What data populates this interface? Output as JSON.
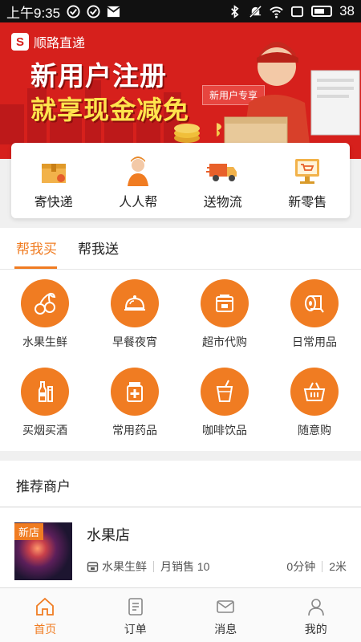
{
  "status_bar": {
    "time": "上午9:35",
    "battery": "38"
  },
  "banner": {
    "brand": "顺路直递",
    "slogan_line1": "新用户注册",
    "slogan_line2": "就享现金减免",
    "tag": "新用户专享"
  },
  "quick_services": [
    {
      "label": "寄快递",
      "icon": "package-icon"
    },
    {
      "label": "人人帮",
      "icon": "courier-icon"
    },
    {
      "label": "送物流",
      "icon": "truck-icon"
    },
    {
      "label": "新零售",
      "icon": "cart-screen-icon"
    }
  ],
  "tabs": {
    "buy": "帮我买",
    "send": "帮我送",
    "active": "buy"
  },
  "categories": [
    {
      "label": "水果生鲜",
      "icon": "cherry-icon"
    },
    {
      "label": "早餐夜宵",
      "icon": "food-dome-icon"
    },
    {
      "label": "超市代购",
      "icon": "store-icon"
    },
    {
      "label": "日常用品",
      "icon": "tissue-roll-icon"
    },
    {
      "label": "买烟买酒",
      "icon": "bottle-icon"
    },
    {
      "label": "常用药品",
      "icon": "medicine-icon"
    },
    {
      "label": "咖啡饮品",
      "icon": "drink-cup-icon"
    },
    {
      "label": "随意购",
      "icon": "basket-icon"
    }
  ],
  "recommend": {
    "title": "推荐商户",
    "merchants": [
      {
        "badge": "新店",
        "name": "水果店",
        "category": "水果生鲜",
        "monthly_sales": "月销售 10",
        "time": "0分钟",
        "distance": "2米"
      }
    ]
  },
  "bottom_nav": [
    {
      "label": "首页",
      "icon": "home-icon"
    },
    {
      "label": "订单",
      "icon": "order-list-icon"
    },
    {
      "label": "消息",
      "icon": "message-icon"
    },
    {
      "label": "我的",
      "icon": "user-icon"
    }
  ],
  "colors": {
    "accent": "#f07c22",
    "banner_red": "#d6201c"
  }
}
